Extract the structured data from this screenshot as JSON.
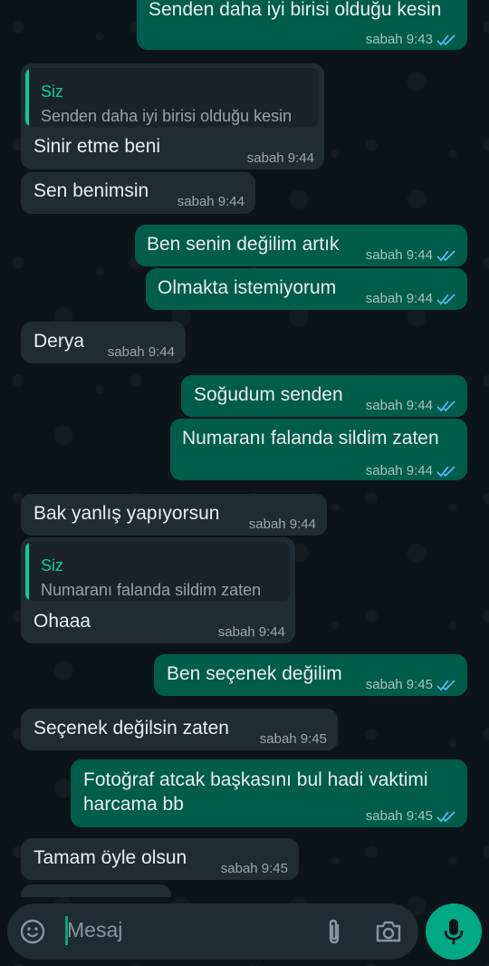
{
  "messages": [
    {
      "dir": "out",
      "text": "Senden daha iyi birisi olduğu kesin",
      "time": "sabah 9:43",
      "ticks": "read"
    },
    {
      "dir": "in",
      "quote": {
        "name": "Siz",
        "text": "Senden daha iyi birisi olduğu kesin"
      },
      "text": "Sinir etme beni",
      "time": "sabah 9:44"
    },
    {
      "dir": "in",
      "text": "Sen benimsin",
      "time": "sabah 9:44"
    },
    {
      "dir": "out",
      "text": "Ben senin değilim artık",
      "time": "sabah 9:44",
      "ticks": "read"
    },
    {
      "dir": "out",
      "text": "Olmakta istemiyorum",
      "time": "sabah 9:44",
      "ticks": "read"
    },
    {
      "dir": "in",
      "text": "Derya",
      "time": "sabah 9:44"
    },
    {
      "dir": "out",
      "text": "Soğudum senden",
      "time": "sabah 9:44",
      "ticks": "read"
    },
    {
      "dir": "out",
      "text": "Numaranı falanda sildim zaten",
      "time": "sabah 9:44",
      "ticks": "read"
    },
    {
      "dir": "in",
      "text": "Bak yanlış yapıyorsun",
      "time": "sabah 9:44"
    },
    {
      "dir": "in",
      "quote": {
        "name": "Siz",
        "text": "Numaranı falanda sildim zaten"
      },
      "text": "Ohaaa",
      "time": "sabah 9:44"
    },
    {
      "dir": "out",
      "text": "Ben seçenek değilim",
      "time": "sabah 9:45",
      "ticks": "read"
    },
    {
      "dir": "in",
      "text": "Seçenek değilsin zaten",
      "time": "sabah 9:45"
    },
    {
      "dir": "out",
      "text_line1": "Fotoğraf atcak başkasını bul hadi vaktimi",
      "text_line2": "harcama bb",
      "time": "sabah 9:45",
      "ticks": "read"
    },
    {
      "dir": "in",
      "text": "Tamam öyle olsun",
      "time": "sabah 9:45"
    }
  ],
  "input": {
    "placeholder": "Mesaj"
  },
  "colors": {
    "incoming": "#202c33",
    "outgoing": "#005c4b",
    "accent": "#00a884",
    "read_ticks": "#53bdeb",
    "quote_name": "#06cf9c"
  },
  "icons": {
    "emoji": "emoji-icon",
    "attach": "paperclip-icon",
    "camera": "camera-icon",
    "mic": "mic-icon",
    "ticks": "double-check-icon"
  }
}
